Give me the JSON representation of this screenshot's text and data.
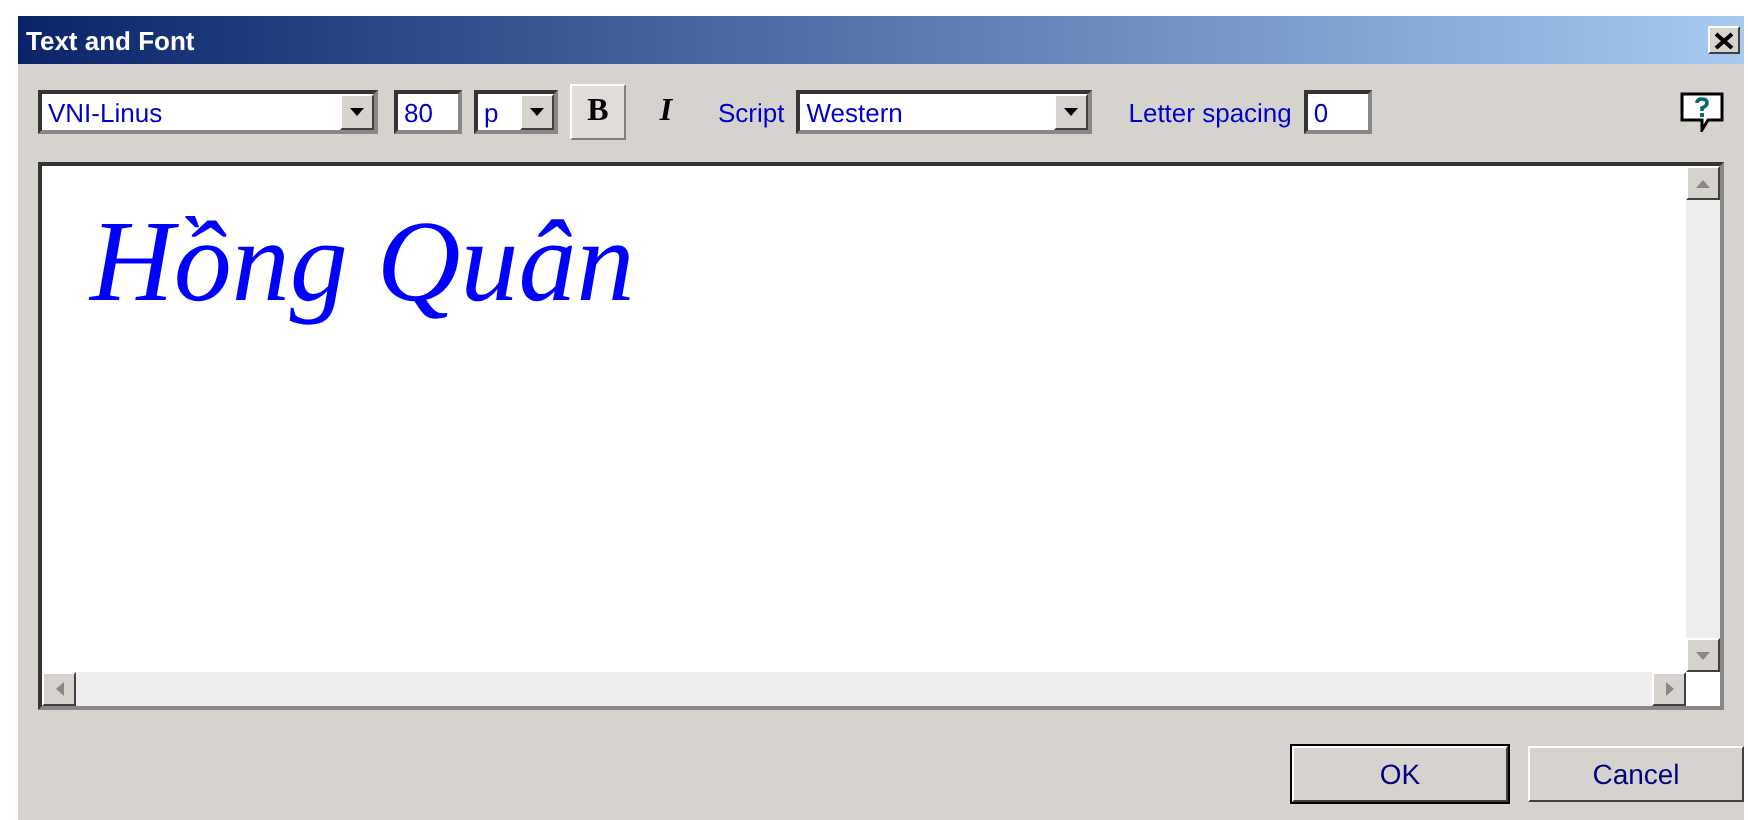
{
  "window": {
    "title": "Text and Font"
  },
  "toolbar": {
    "font": "VNI-Linus",
    "size": "80",
    "unit": "p",
    "bold": {
      "label": "B",
      "selected": true
    },
    "italic": {
      "label": "I",
      "selected": false
    },
    "script_label": "Script",
    "script": "Western",
    "letter_spacing_label": "Letter spacing",
    "letter_spacing": "0"
  },
  "editor": {
    "text": "Hồng Quân"
  },
  "buttons": [
    "OK",
    "Cancel"
  ]
}
